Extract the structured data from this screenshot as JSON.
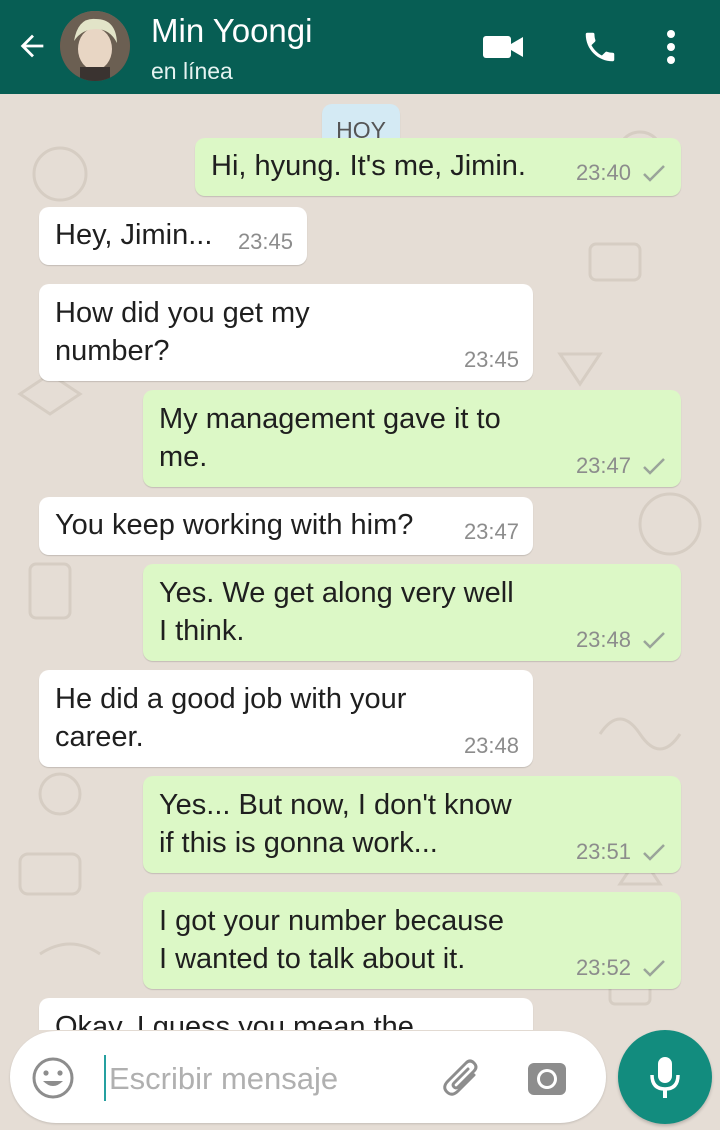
{
  "header": {
    "contact_name": "Min Yoongi",
    "status": "en línea",
    "color": "#075e54"
  },
  "chat": {
    "day_label": "HOY",
    "messages": [
      {
        "dir": "out",
        "text": "Hi, hyung. It's me, Jimin.",
        "time": "23:40"
      },
      {
        "dir": "in",
        "text": "Hey, Jimin...",
        "time": "23:45"
      },
      {
        "dir": "in",
        "text": "How did you get my\nnumber?",
        "time": "23:45"
      },
      {
        "dir": "out",
        "text": "My management gave it to\nme.",
        "time": "23:47"
      },
      {
        "dir": "in",
        "text": "You keep working with him?",
        "time": "23:47"
      },
      {
        "dir": "out",
        "text": "Yes. We get along very well\nI think.",
        "time": "23:48"
      },
      {
        "dir": "in",
        "text": "He did a good job with your\ncareer.",
        "time": "23:48"
      },
      {
        "dir": "out",
        "text": "Yes... But now, I don't know\nif this is gonna work...",
        "time": "23:51"
      },
      {
        "dir": "out",
        "text": "I got your number because\nI wanted to talk about it.",
        "time": "23:52"
      },
      {
        "dir": "in",
        "text": "Okay, I guess you mean the",
        "time": ""
      }
    ],
    "colors": {
      "incoming": "#ffffff",
      "outgoing": "#dcf8c6",
      "wallpaper": "#e5ddd5"
    }
  },
  "composer": {
    "placeholder": "Escribir mensaje",
    "accent": "#128c7e"
  },
  "icons": {
    "back": "arrow-left-icon",
    "video": "video-camera-icon",
    "call": "phone-icon",
    "menu": "more-vert-icon",
    "emoji": "smiley-icon",
    "attach": "paperclip-icon",
    "camera": "camera-icon",
    "mic": "microphone-icon",
    "sent": "check-icon"
  }
}
